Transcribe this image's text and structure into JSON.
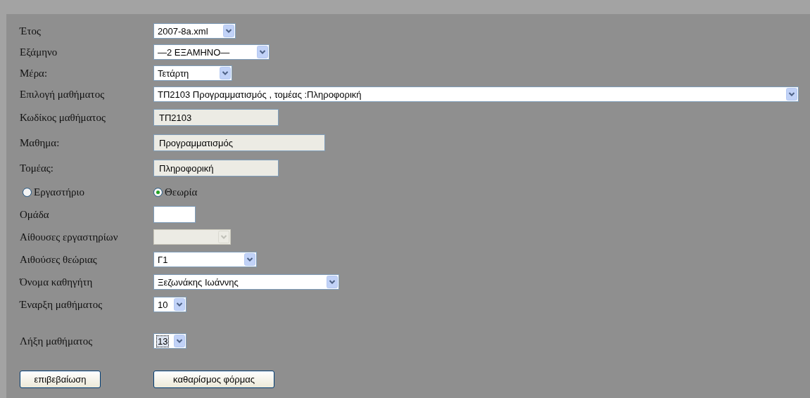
{
  "form": {
    "fields": [
      {
        "kind": "select",
        "label": "Έτος",
        "value": "2007-8a.xml",
        "disabled": false,
        "focused": false
      },
      {
        "kind": "select",
        "label": "Εξάμηνο",
        "value": "—2 ΕΞΑΜΗΝΟ—",
        "disabled": false,
        "focused": false
      },
      {
        "kind": "select",
        "label": "Μέρα:",
        "value": "Τετάρτη",
        "disabled": false,
        "focused": false
      },
      {
        "kind": "select",
        "label": "Επιλογή μαθήματος",
        "value": "ΤΠ2103 Προγραμματισμός , τομέας :Πληροφορική",
        "disabled": false,
        "focused": false
      },
      {
        "kind": "text",
        "label": "Κωδίκος μαθήματος",
        "value": "ΤΠ2103",
        "readonly": true
      },
      {
        "kind": "text",
        "label": "Μαθημα:",
        "value": "Προγραμματισμός",
        "readonly": true
      },
      {
        "kind": "text",
        "label": "Τομέας:",
        "value": "Πληροφορική",
        "readonly": true
      },
      {
        "kind": "radios",
        "options": [
          {
            "label": "Εργαστήριο",
            "selected": false
          },
          {
            "label": "Θεωρία",
            "selected": true
          }
        ]
      },
      {
        "kind": "text",
        "label": "Ομάδα",
        "readonly": false
      },
      {
        "kind": "select",
        "label": "Αίθουσες εργαστηρίων",
        "disabled": true,
        "focused": false
      },
      {
        "kind": "select",
        "label": "Αιθούσες θεώριας",
        "value": "Γ1",
        "disabled": false,
        "focused": false
      },
      {
        "kind": "select",
        "label": "Όνομα καθηγήτη",
        "value": "Ξεζωνάκης Ιωάννης",
        "disabled": false,
        "focused": false
      },
      {
        "kind": "select",
        "label": "Έναρξη μαθήματος",
        "value": "10",
        "disabled": false,
        "focused": false
      },
      {
        "kind": "select",
        "label": "Λήξη μαθήματος",
        "value": "13",
        "disabled": false,
        "focused": true
      }
    ],
    "buttons": [
      "επιβεβαίωση",
      "καθαρίσμος φόρμας"
    ]
  }
}
